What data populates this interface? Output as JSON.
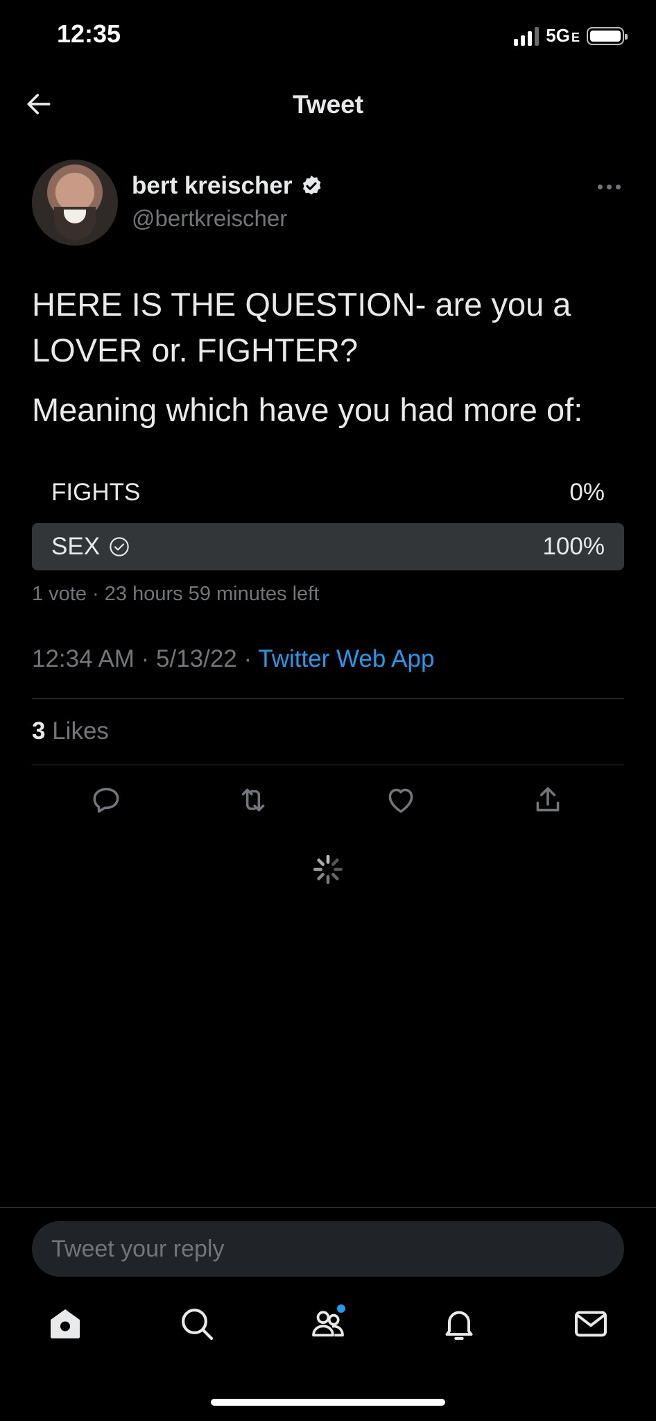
{
  "status_bar": {
    "time": "12:35",
    "network": "5G",
    "network_suffix": "E"
  },
  "header": {
    "title": "Tweet"
  },
  "author": {
    "name": "bert kreischer",
    "handle": "@bertkreischer"
  },
  "tweet": {
    "text_line1": "HERE IS THE QUESTION- are you a LOVER or. FIGHTER?",
    "text_line2": "Meaning which have you had more of:"
  },
  "poll": {
    "options": [
      {
        "label": "FIGHTS",
        "percent": "0%"
      },
      {
        "label": "SEX",
        "percent": "100%"
      }
    ],
    "meta": "1 vote · 23 hours 59 minutes left"
  },
  "timestamp": {
    "time": "12:34 AM",
    "sep1": " · ",
    "date": "5/13/22",
    "sep2": " · ",
    "source": "Twitter Web App"
  },
  "stats": {
    "likes_count": "3",
    "likes_label": "Likes"
  },
  "reply": {
    "placeholder": "Tweet your reply"
  },
  "colors": {
    "accent": "#1d9bf0",
    "background": "#000000",
    "secondary_text": "#71767b"
  }
}
